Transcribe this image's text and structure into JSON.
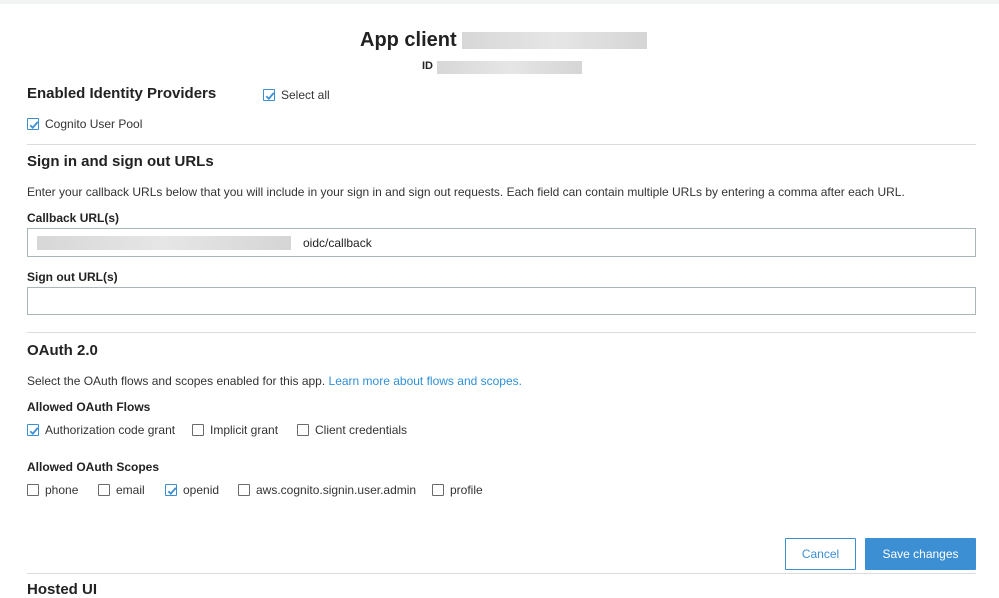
{
  "header": {
    "title": "App client",
    "id_label": "ID"
  },
  "identity_providers": {
    "heading": "Enabled Identity Providers",
    "select_all_label": "Select all",
    "providers": [
      {
        "label": "Cognito User Pool",
        "checked": true
      }
    ]
  },
  "urls": {
    "heading": "Sign in and sign out URLs",
    "description": "Enter your callback URLs below that you will include in your sign in and sign out requests. Each field can contain multiple URLs by entering a comma after each URL.",
    "callback_label": "Callback URL(s)",
    "callback_value_suffix": "oidc/callback",
    "signout_label": "Sign out URL(s)",
    "signout_value": ""
  },
  "oauth": {
    "heading": "OAuth 2.0",
    "description": "Select the OAuth flows and scopes enabled for this app.",
    "learn_more_link": "Learn more about flows and scopes.",
    "flows_label": "Allowed OAuth Flows",
    "flows": [
      {
        "label": "Authorization code grant",
        "checked": true
      },
      {
        "label": "Implicit grant",
        "checked": false
      },
      {
        "label": "Client credentials",
        "checked": false
      }
    ],
    "scopes_label": "Allowed OAuth Scopes",
    "scopes": [
      {
        "label": "phone",
        "checked": false
      },
      {
        "label": "email",
        "checked": false
      },
      {
        "label": "openid",
        "checked": true
      },
      {
        "label": "aws.cognito.signin.user.admin",
        "checked": false
      },
      {
        "label": "profile",
        "checked": false
      }
    ]
  },
  "actions": {
    "cancel_label": "Cancel",
    "save_label": "Save changes"
  },
  "next_section": {
    "heading": "Hosted UI"
  },
  "colors": {
    "accent": "#3d8fd3",
    "link": "#2f8fd8",
    "border": "#aab7b8"
  }
}
